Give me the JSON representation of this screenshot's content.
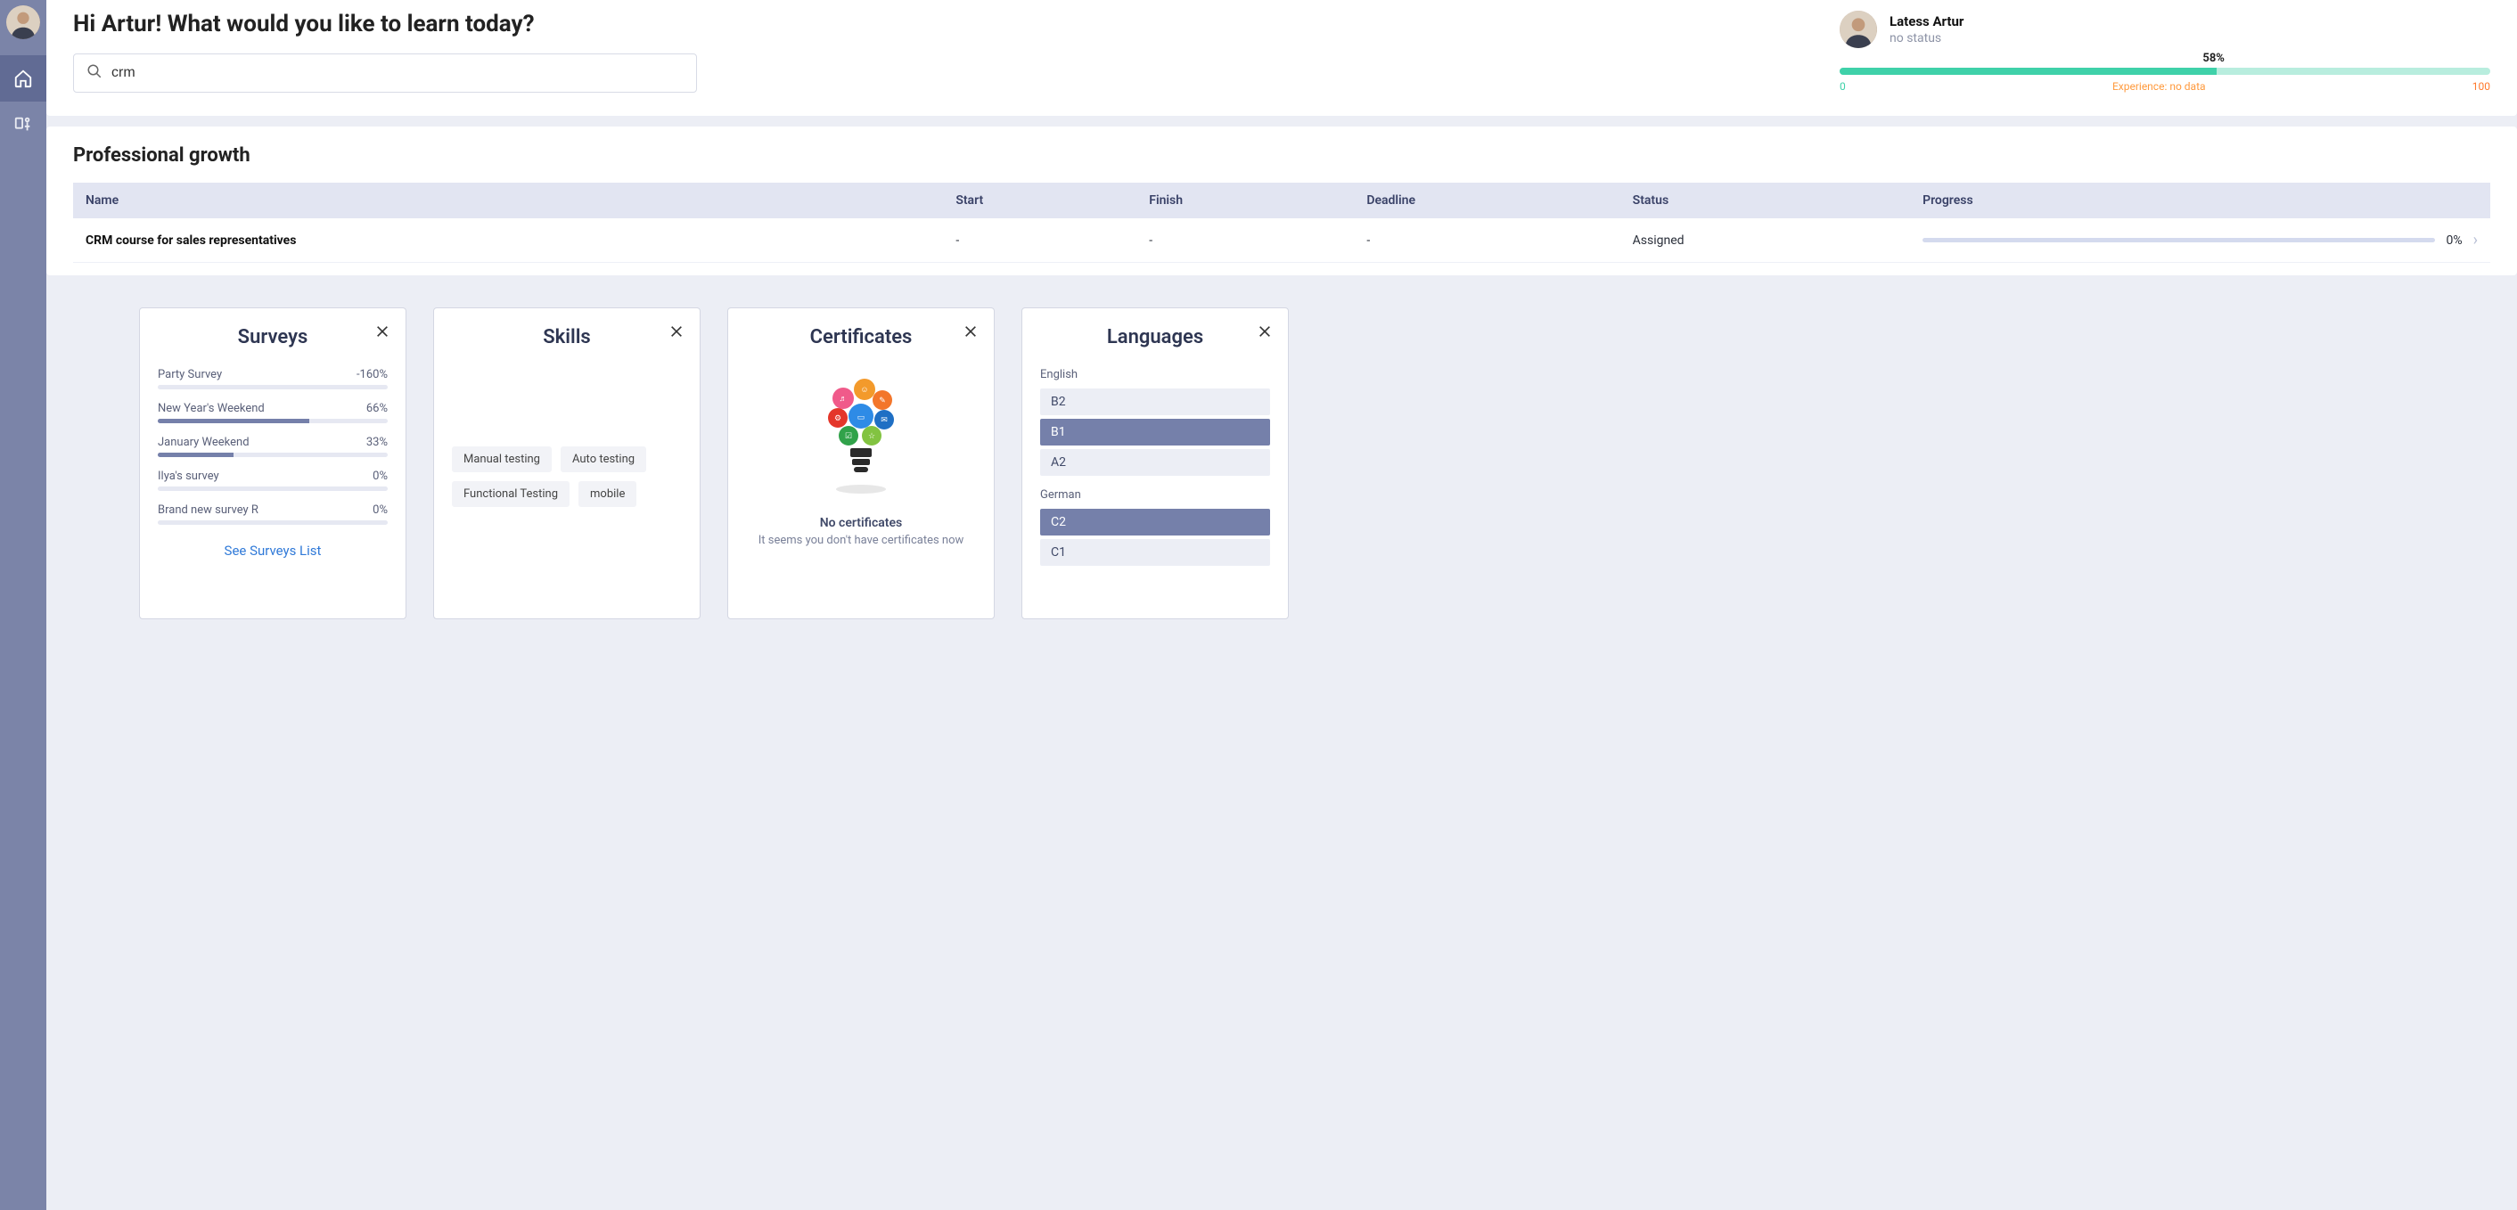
{
  "sidebar": {
    "avatar_alt": "User avatar"
  },
  "header": {
    "greeting": "Hi Artur! What would you like to learn today?",
    "search_value": "crm"
  },
  "profile": {
    "name": "Latess Artur",
    "status": "no status",
    "xp_percent": 58,
    "xp_percent_label": "58%",
    "xp_min": "0",
    "xp_label_prefix": "Experience: ",
    "xp_label_value": "no data",
    "xp_max": "100"
  },
  "growth": {
    "title": "Professional growth",
    "columns": {
      "name": "Name",
      "start": "Start",
      "finish": "Finish",
      "deadline": "Deadline",
      "status": "Status",
      "progress": "Progress"
    },
    "rows": [
      {
        "name": "CRM course for sales representatives",
        "start": "-",
        "finish": "-",
        "deadline": "-",
        "status": "Assigned",
        "progress_pct": 0,
        "progress_label": "0%"
      }
    ]
  },
  "cards": {
    "surveys": {
      "title": "Surveys",
      "items": [
        {
          "name": "Party Survey",
          "pct_label": "-160%",
          "fill": 0
        },
        {
          "name": "New Year's Weekend",
          "pct_label": "66%",
          "fill": 66
        },
        {
          "name": "January Weekend",
          "pct_label": "33%",
          "fill": 33
        },
        {
          "name": "Ilya's survey",
          "pct_label": "0%",
          "fill": 0
        },
        {
          "name": "Brand new survey R",
          "pct_label": "0%",
          "fill": 0
        }
      ],
      "link": "See Surveys List"
    },
    "skills": {
      "title": "Skills",
      "items": [
        "Manual testing",
        "Auto testing",
        "Functional Testing",
        "mobile"
      ]
    },
    "certificates": {
      "title": "Certificates",
      "none_title": "No certificates",
      "none_sub": "It seems you don't have certificates now"
    },
    "languages": {
      "title": "Languages",
      "groups": [
        {
          "name": "English",
          "levels": [
            {
              "label": "B2",
              "selected": false
            },
            {
              "label": "B1",
              "selected": true
            },
            {
              "label": "A2",
              "selected": false
            }
          ]
        },
        {
          "name": "German",
          "levels": [
            {
              "label": "C2",
              "selected": true
            },
            {
              "label": "C1",
              "selected": false
            }
          ]
        }
      ]
    }
  }
}
